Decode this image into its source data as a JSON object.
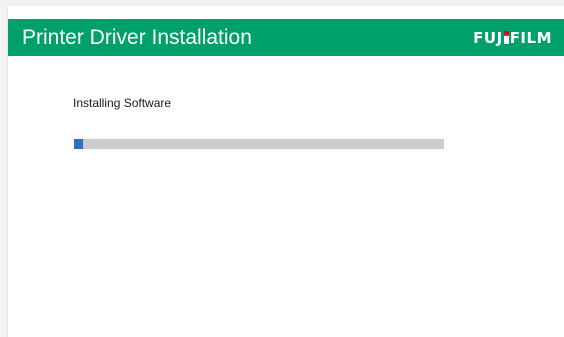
{
  "window": {
    "title": "Printer Driver Installation",
    "brand": {
      "text_before": "FUJ",
      "text_after": "FILM",
      "full_text": "FUJIFILM",
      "header_color": "#00a06b",
      "accent_color": "#e60012"
    }
  },
  "install": {
    "status_label": "Installing Software",
    "progress_fraction": 0.025,
    "progress_color": "#2f6fbf",
    "track_color": "#cccccc"
  }
}
